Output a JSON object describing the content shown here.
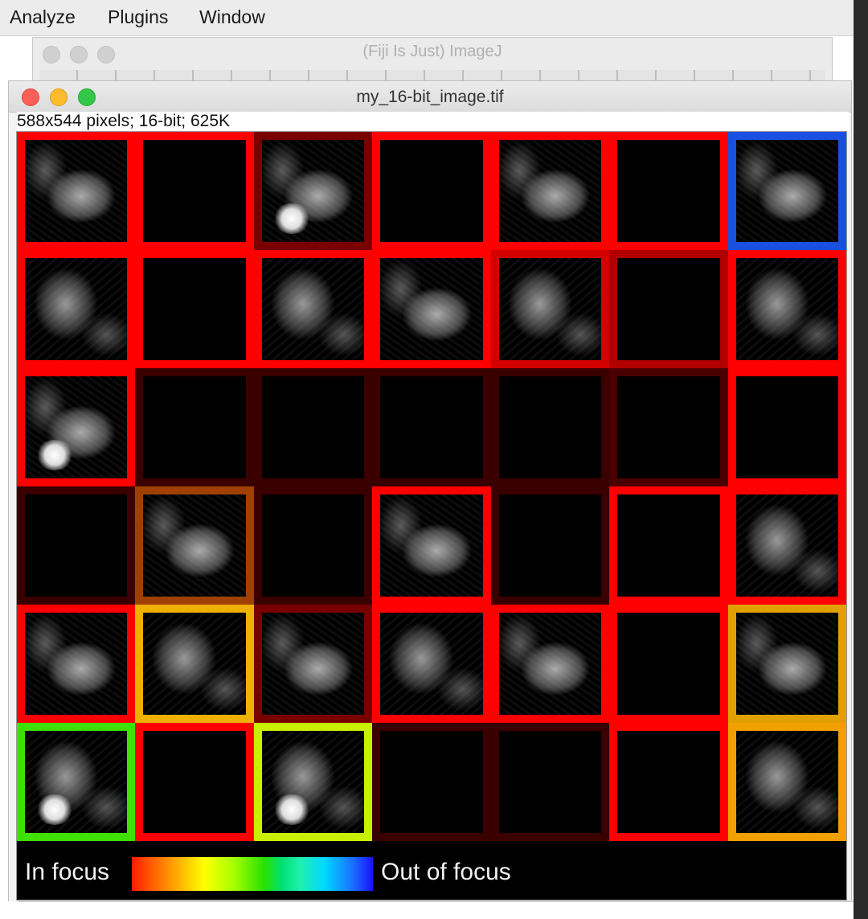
{
  "menubar": {
    "items": [
      "Analyze",
      "Plugins",
      "Window"
    ]
  },
  "fiji_window": {
    "title": "(Fiji Is Just) ImageJ"
  },
  "image_window": {
    "title": "my_16-bit_image.tif",
    "subtitle": "588x544 pixels; 16-bit; 625K"
  },
  "tiles": [
    {
      "color": "#ff0000",
      "content": "cells"
    },
    {
      "color": "#ff0000",
      "content": "dark"
    },
    {
      "color": "#7a0000",
      "content": "bright"
    },
    {
      "color": "#ff0000",
      "content": "dark"
    },
    {
      "color": "#ff0000",
      "content": "cells"
    },
    {
      "color": "#ff0000",
      "content": "dark"
    },
    {
      "color": "#1a50e0",
      "content": "cells"
    },
    {
      "color": "#ff0000",
      "content": "cells"
    },
    {
      "color": "#ff0000",
      "content": "dark"
    },
    {
      "color": "#ff0000",
      "content": "cells"
    },
    {
      "color": "#ff0000",
      "content": "cells"
    },
    {
      "color": "#d40000",
      "content": "cells"
    },
    {
      "color": "#b00000",
      "content": "dark"
    },
    {
      "color": "#ff0000",
      "content": "cells"
    },
    {
      "color": "#ff0000",
      "content": "bright"
    },
    {
      "color": "#3a0000",
      "content": "dark"
    },
    {
      "color": "#3a0000",
      "content": "dark"
    },
    {
      "color": "#3a0000",
      "content": "dark"
    },
    {
      "color": "#3a0000",
      "content": "dark"
    },
    {
      "color": "#4a0000",
      "content": "dark"
    },
    {
      "color": "#ff0000",
      "content": "dark"
    },
    {
      "color": "#3a0000",
      "content": "dark"
    },
    {
      "color": "#a04000",
      "content": "cells"
    },
    {
      "color": "#3a0000",
      "content": "dark"
    },
    {
      "color": "#ff0000",
      "content": "cells"
    },
    {
      "color": "#3a0000",
      "content": "dark"
    },
    {
      "color": "#ff0000",
      "content": "dark"
    },
    {
      "color": "#ff0000",
      "content": "cells"
    },
    {
      "color": "#ff0000",
      "content": "cells"
    },
    {
      "color": "#f0b000",
      "content": "cells"
    },
    {
      "color": "#7a0000",
      "content": "cells"
    },
    {
      "color": "#ff0000",
      "content": "cells"
    },
    {
      "color": "#ff0000",
      "content": "cells"
    },
    {
      "color": "#ff0000",
      "content": "dark"
    },
    {
      "color": "#e0a000",
      "content": "cells"
    },
    {
      "color": "#40e000",
      "content": "bright"
    },
    {
      "color": "#ff0000",
      "content": "dark"
    },
    {
      "color": "#c8f000",
      "content": "bright"
    },
    {
      "color": "#3a0000",
      "content": "dark"
    },
    {
      "color": "#3a0000",
      "content": "dark"
    },
    {
      "color": "#ff0000",
      "content": "dark"
    },
    {
      "color": "#f0a000",
      "content": "cells"
    }
  ],
  "legend": {
    "left_label": "In focus",
    "right_label": "Out of focus"
  }
}
